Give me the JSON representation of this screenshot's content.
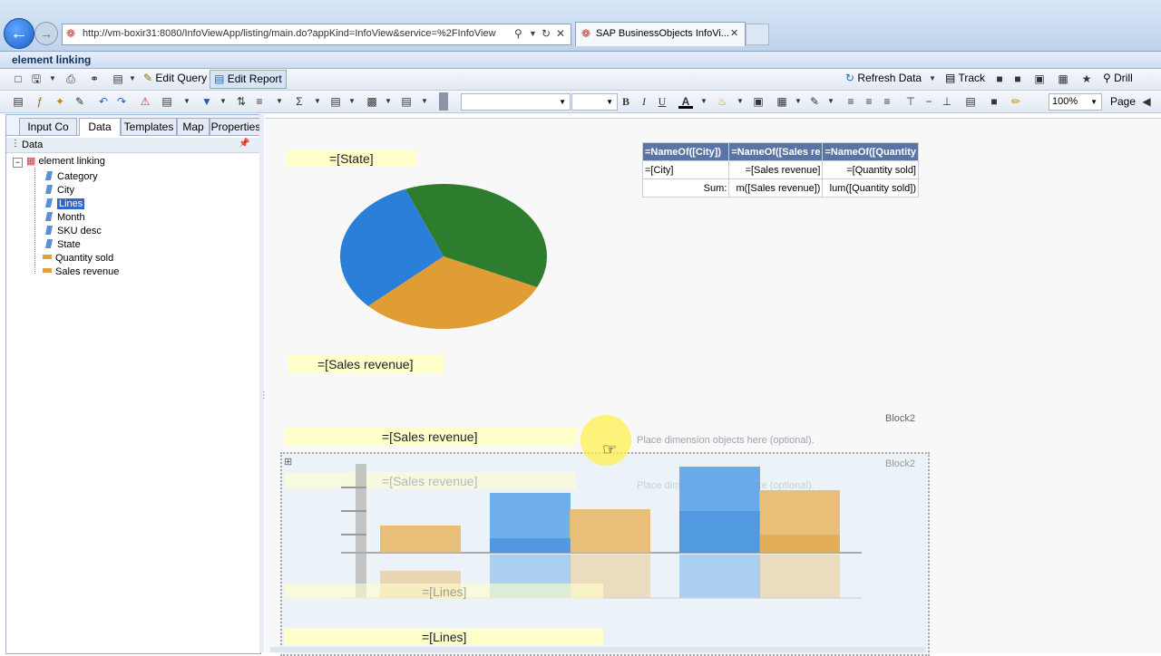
{
  "browser": {
    "url": "http://vm-boxir31:8080/InfoViewApp/listing/main.do?appKind=InfoView&service=%2FInfoView",
    "tab_title": "SAP BusinessObjects InfoVi...",
    "back_icon": "back-arrow-icon",
    "forward_icon": "forward-arrow-icon"
  },
  "app": {
    "title": "element linking"
  },
  "toolbar1": {
    "edit_query": "Edit Query",
    "edit_report": "Edit Report",
    "refresh_data": "Refresh Data",
    "track": "Track",
    "drill": "Drill"
  },
  "toolbar2": {
    "bold": "B",
    "italic": "I",
    "underline": "U",
    "text_color": "A",
    "zoom": "100%",
    "page": "Page"
  },
  "left_panel": {
    "tabs": [
      {
        "label": "Input Co",
        "active": false
      },
      {
        "label": "Data",
        "active": true
      },
      {
        "label": "Templates",
        "active": false
      },
      {
        "label": "Map",
        "active": false
      },
      {
        "label": "Properties",
        "active": false
      }
    ],
    "data_header": "Data",
    "tree_root": "element linking",
    "tree_items": [
      {
        "label": "Category",
        "type": "dimension"
      },
      {
        "label": "City",
        "type": "dimension"
      },
      {
        "label": "Lines",
        "type": "dimension",
        "selected": true
      },
      {
        "label": "Month",
        "type": "dimension"
      },
      {
        "label": "SKU desc",
        "type": "dimension"
      },
      {
        "label": "State",
        "type": "dimension"
      },
      {
        "label": "Quantity sold",
        "type": "measure"
      },
      {
        "label": "Sales revenue",
        "type": "measure"
      }
    ]
  },
  "report": {
    "pie_title": "=[State]",
    "pie_footer": "=[Sales revenue]",
    "pie_slices": [
      {
        "value": 38,
        "color": "#2e7d2e"
      },
      {
        "value": 31,
        "color": "#e09c35"
      },
      {
        "value": 31,
        "color": "#2a7fd8"
      }
    ],
    "table": {
      "headers": [
        "=NameOf([City])",
        "=NameOf([Sales re",
        "=NameOf([Quantity"
      ],
      "row": [
        "=[City]",
        "=[Sales revenue]",
        "=[Quantity sold]"
      ],
      "sum_row": [
        "Sum:",
        "m([Sales revenue])",
        "lum([Quantity sold])"
      ]
    },
    "block2_label": "Block2",
    "block2_label_ghost": "Block2",
    "bar_chart_title": "=[Sales revenue]",
    "bar_chart_title_ghost": "=[Sales revenue]",
    "place_hint": "Place dimension objects here (optional).",
    "place_hint_ghost": "Place dimension objects here (optional).",
    "bar_chart_axis": "=[Lines]",
    "bar_chart_axis_ghost": "=[Lines]",
    "bar_colors": {
      "blue": "#5aa3e8",
      "orange": "#e8b86a"
    }
  }
}
